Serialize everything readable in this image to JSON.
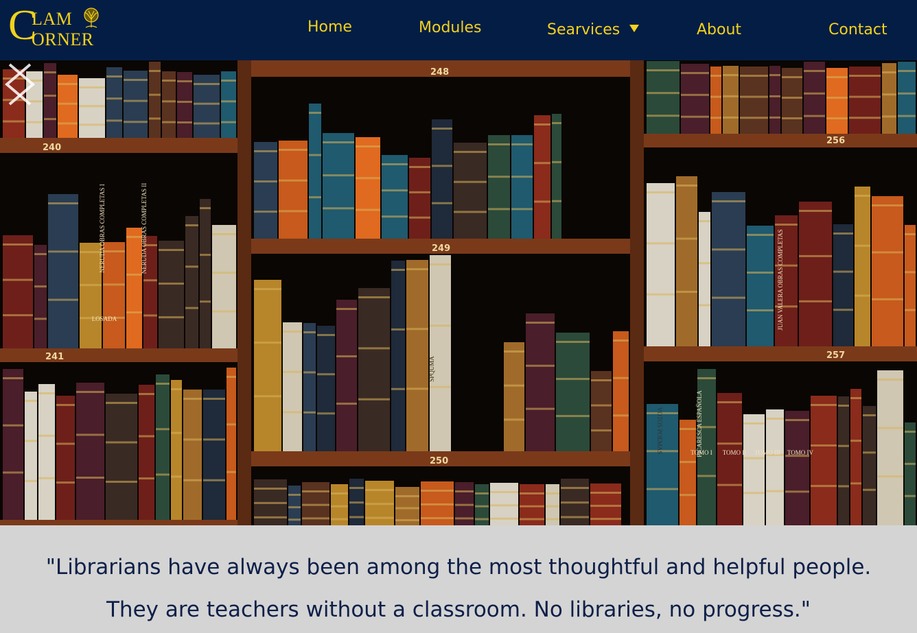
{
  "brand": {
    "logo_letter_c": "C",
    "logo_line1": "LAM",
    "logo_line2": "ORNER",
    "logo_icon": "tree-icon",
    "accent_color": "#f2d21c",
    "nav_background": "#041d45"
  },
  "nav": {
    "home": "Home",
    "modules": "Modules",
    "services": "Searvices",
    "services_icon": "caret-down-icon",
    "about": "About",
    "contact": "Contact"
  },
  "hero": {
    "image": "bookshelf-photo",
    "shelf_labels": [
      "248",
      "240",
      "256",
      "249",
      "241",
      "257",
      "250"
    ],
    "book_titles": [
      "NERUDA OBRAS COMPLETAS I",
      "NERUDA OBRAS COMPLETAS II",
      "LOSADA",
      "JUAN VALERA OBRAS COMPLETAS",
      "PICARESCA ESPAÑOLA",
      "TOMO I",
      "TOMO II",
      "TOMO III",
      "TOMO IV",
      "VOTOS POEMAS",
      "SPQUMA"
    ],
    "prev_icon": "chevron-left-icon",
    "next_icon": "chevron-right-icon"
  },
  "quote": {
    "text": "\"Librarians have always been among the most thoughtful and helpful people. They are teachers without a classroom. No libraries, no progress.\""
  }
}
